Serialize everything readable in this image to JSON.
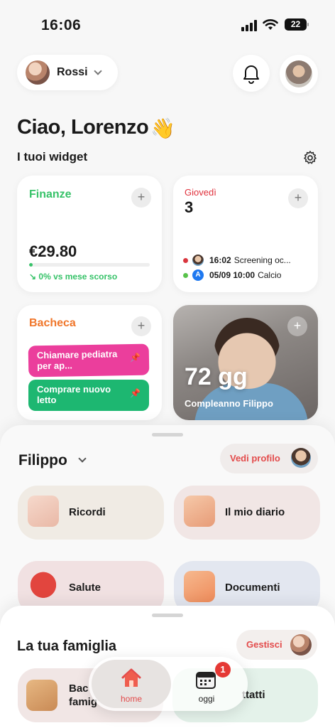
{
  "status": {
    "time": "16:06",
    "battery": "22"
  },
  "header": {
    "family_name": "Rossi"
  },
  "greeting": "Ciao, Lorenzo",
  "wave_emoji": "👋",
  "widgets": {
    "title": "I tuoi widget",
    "finance": {
      "title": "Finanze",
      "amount": "€29.80",
      "trend": "0% vs mese scorso",
      "progress": 0.03,
      "color": "#36c268"
    },
    "calendar": {
      "day": "Giovedì",
      "date": "3",
      "events": [
        {
          "time": "16:02",
          "text": "Screening oc...",
          "dot": "#d9363e",
          "avatar": "photo"
        },
        {
          "time": "05/09 10:00",
          "text": "Calcio",
          "dot": "#58c24a",
          "avatar": "A"
        }
      ]
    },
    "board": {
      "title": "Bacheca",
      "notes": [
        "Chiamare pediatra per ap...",
        "Comprare nuovo letto"
      ]
    },
    "birthday": {
      "days": "72 gg",
      "caption": "Compleanno Filippo"
    }
  },
  "child": {
    "name": "Filippo",
    "profile_button": "Vedi profilo",
    "tiles": [
      {
        "label": "Ricordi",
        "icon": "camera-icon"
      },
      {
        "label": "Il mio diario",
        "icon": "diary-icon"
      },
      {
        "label": "Salute",
        "icon": "heart-icon"
      },
      {
        "label": "Documenti",
        "icon": "folder-icon"
      }
    ]
  },
  "family": {
    "title": "La tua famiglia",
    "manage_button": "Gestisci",
    "tiles": [
      {
        "label": "Bacheca famiglia",
        "line1": "Bac",
        "line2": "famig"
      },
      {
        "label": "Contatti",
        "visible": "ttatti"
      }
    ]
  },
  "tabbar": {
    "home": "home",
    "oggi": "oggi",
    "badge": "1"
  },
  "colors": {
    "accent": "#e34b4b",
    "green": "#36c268",
    "orange": "#f0762a",
    "pink": "#eb3e9c"
  }
}
